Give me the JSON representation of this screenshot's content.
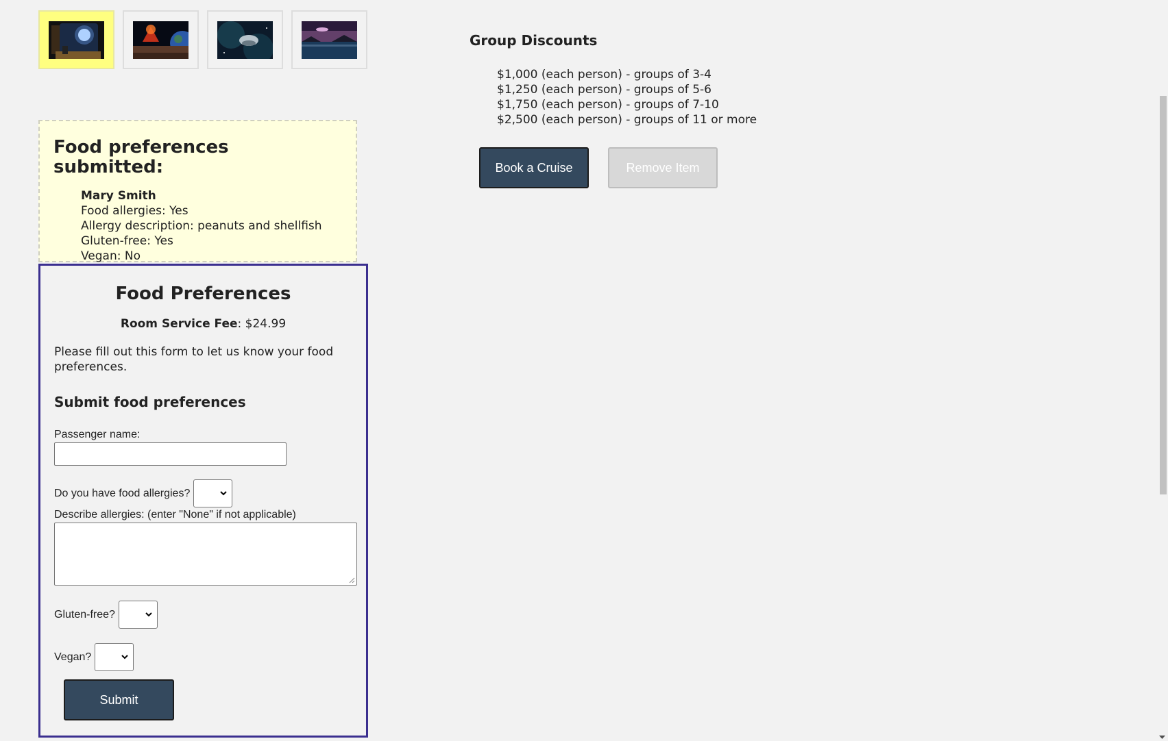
{
  "thumbnails": [
    {
      "name": "space-window-thumbnail",
      "active": true
    },
    {
      "name": "planet-eruption-thumbnail",
      "active": false
    },
    {
      "name": "nebula-ship-thumbnail",
      "active": false
    },
    {
      "name": "lake-ufo-thumbnail",
      "active": false
    }
  ],
  "submitted": {
    "title": "Food preferences submitted:",
    "name": "Mary Smith",
    "allergies": "Food allergies: Yes",
    "allergy_description": "Allergy description: peanuts and shellfish",
    "gluten_free": "Gluten-free: Yes",
    "vegan": "Vegan: No"
  },
  "form": {
    "title": "Food Preferences",
    "fee_label": "Room Service Fee",
    "fee_value": ": $24.99",
    "intro": "Please fill out this form to let us know your food preferences.",
    "subtitle": "Submit food preferences",
    "passenger_label": "Passenger name:",
    "passenger_value": "",
    "allergies_label": "Do you have food allergies?",
    "allergies_value": "",
    "describe_label": "Describe allergies: (enter \"None\" if not applicable)",
    "describe_value": "",
    "gluten_label": "Gluten-free?",
    "gluten_value": "",
    "vegan_label": "Vegan?",
    "vegan_value": "",
    "submit_label": "Submit"
  },
  "discounts": {
    "title": "Group Discounts",
    "items": [
      "$1,000 (each person) - groups of 3-4",
      "$1,250 (each person) - groups of 5-6",
      "$1,750 (each person) - groups of 7-10",
      "$2,500 (each person) - groups of 11 or more"
    ]
  },
  "actions": {
    "book_label": "Book a Cruise",
    "remove_label": "Remove Item"
  },
  "colors": {
    "button_primary": "#34495e",
    "button_disabled": "#d8d8d8",
    "submitted_bg": "#ffffde",
    "active_thumb_bg": "#ffff80",
    "form_border": "#3b2f8f"
  }
}
